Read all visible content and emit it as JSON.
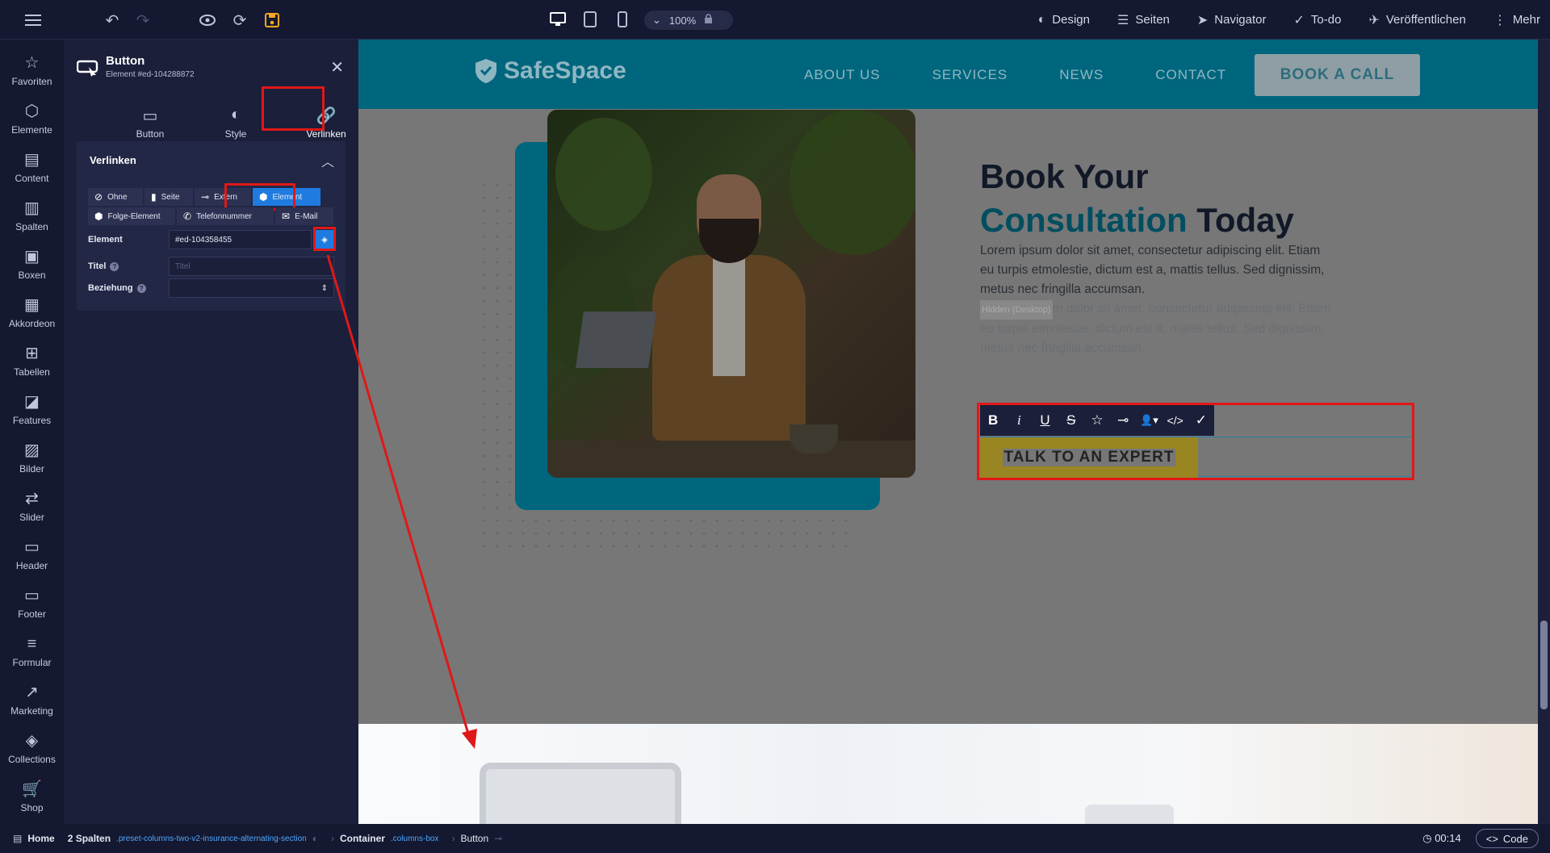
{
  "topbar": {
    "zoom": "100%",
    "menu": [
      {
        "icon": "palette-icon",
        "label": "Design"
      },
      {
        "icon": "list-icon",
        "label": "Seiten"
      },
      {
        "icon": "navigation-icon",
        "label": "Navigator"
      },
      {
        "icon": "check-circle-icon",
        "label": "To-do"
      },
      {
        "icon": "rocket-icon",
        "label": "Veröffentlichen"
      },
      {
        "icon": "more-vertical-icon",
        "label": "Mehr"
      }
    ]
  },
  "rail": {
    "items": [
      {
        "icon": "star-icon",
        "label": "Favoriten"
      },
      {
        "icon": "cube-icon",
        "label": "Elemente"
      },
      {
        "icon": "document-icon",
        "label": "Content"
      },
      {
        "icon": "columns-icon",
        "label": "Spalten"
      },
      {
        "icon": "box-icon",
        "label": "Boxen"
      },
      {
        "icon": "accordion-icon",
        "label": "Akkordeon"
      },
      {
        "icon": "table-icon",
        "label": "Tabellen"
      },
      {
        "icon": "shapes-icon",
        "label": "Features"
      },
      {
        "icon": "image-icon",
        "label": "Bilder"
      },
      {
        "icon": "arrows-icon",
        "label": "Slider"
      },
      {
        "icon": "header-icon",
        "label": "Header"
      },
      {
        "icon": "footer-icon",
        "label": "Footer"
      },
      {
        "icon": "form-icon",
        "label": "Formular"
      },
      {
        "icon": "chart-trend-icon",
        "label": "Marketing"
      },
      {
        "icon": "layers-icon",
        "label": "Collections"
      },
      {
        "icon": "cart-icon",
        "label": "Shop"
      }
    ]
  },
  "panel": {
    "title": "Button",
    "subtitle": "Element #ed-104288872",
    "tabs": [
      {
        "label": "Button",
        "icon": "button-icon"
      },
      {
        "label": "Style",
        "icon": "palette-icon"
      },
      {
        "label": "Verlinken",
        "icon": "link-icon"
      }
    ],
    "section_title": "Verlinken",
    "link_types_row1": [
      {
        "label": "Ohne",
        "icon": "ban-icon"
      },
      {
        "label": "Seite",
        "icon": "page-icon"
      },
      {
        "label": "Extern",
        "icon": "link-icon"
      },
      {
        "label": "Element",
        "icon": "cube-icon"
      }
    ],
    "link_types_row2": [
      {
        "label": "Folge-Element",
        "icon": "cube-icon"
      },
      {
        "label": "Telefonnummer",
        "icon": "phone-icon"
      },
      {
        "label": "E-Mail",
        "icon": "mail-icon"
      }
    ],
    "fields": {
      "element_label": "Element",
      "element_value": "#ed-104358455",
      "titel_label": "Titel",
      "titel_placeholder": "Titel",
      "beziehung_label": "Beziehung"
    }
  },
  "site": {
    "logo": "SafeSpace",
    "nav": [
      "ABOUT US",
      "SERVICES",
      "NEWS",
      "CONTACT"
    ],
    "cta": "BOOK A CALL",
    "heading_line1": "Book Your",
    "heading_accent": "Consultation",
    "heading_rest": " Today",
    "paragraph": "Lorem ipsum dolor sit amet, consectetur adipiscing elit. Etiam eu turpis etmolestie, dictum est a, mattis tellus. Sed dignissim, metus nec fringilla accumsan.",
    "hidden_tag": "Hidden (Desktop)",
    "paragraph_hidden": "m dolor sit amet, consectetur adipiscing elit. Etiam eu turpis etmolestie, dictum est a, mattis tellus. Sed dignissim, metus nec fringilla accumsan.",
    "button": "TALK TO AN EXPERT"
  },
  "status": {
    "crumbs": [
      {
        "label": "Home",
        "class": ""
      },
      {
        "label": "2 Spalten",
        "class": ".preset-columns-two-v2-insurance-alternating-section"
      },
      {
        "label": "Container",
        "class": ".columns-box"
      },
      {
        "label": "Button",
        "class": ""
      }
    ],
    "timer": "00:14",
    "code": "Code"
  },
  "colors": {
    "accent": "#1f7be0",
    "annotation": "#e01818",
    "site_teal": "#00667d"
  }
}
